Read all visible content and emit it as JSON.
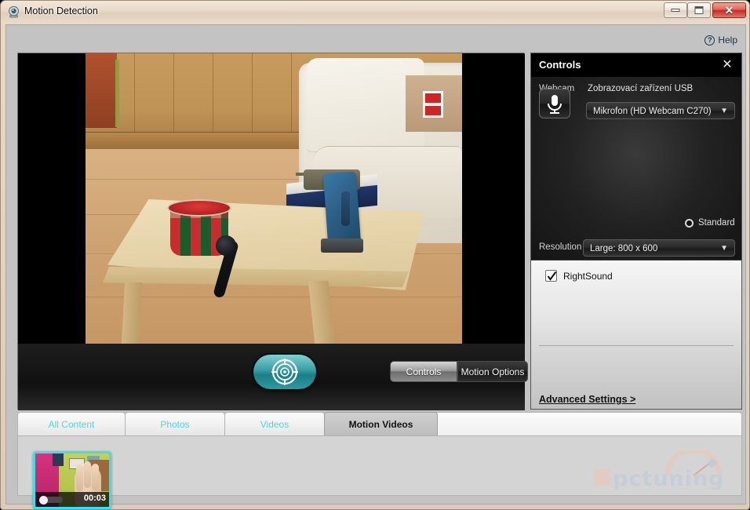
{
  "window": {
    "title": "Motion Detection",
    "icon": "webcam-icon",
    "minimize_label": "Minimize",
    "maximize_label": "Maximize",
    "close_label": "Close"
  },
  "help": {
    "label": "Help",
    "icon": "question-mark-icon"
  },
  "video": {
    "record_button_icon": "motion-target-icon",
    "segmented": {
      "controls_label": "Controls",
      "motion_options_label": "Motion Options",
      "active": "Controls"
    }
  },
  "controls": {
    "title": "Controls",
    "close_icon": "close-icon",
    "webcam_label": "Webcam",
    "webcam_value": "Zobrazovací zařízení USB",
    "mic_label": "Mic",
    "mic_value": "Mikrofon (HD Webcam C270)",
    "mic_button_icon": "microphone-icon",
    "quality_label": "Standard",
    "quality_radio_icon": "radio-selected-icon",
    "resolution_label": "Resolution",
    "resolution_value": "Large: 800 x 600",
    "rightsound_label": "RightSound",
    "rightsound_checked": true,
    "advanced_settings_label": "Advanced Settings >",
    "accent_color": "#3ce0ec"
  },
  "tabs": [
    {
      "label": "All Content",
      "active": false
    },
    {
      "label": "Photos",
      "active": false
    },
    {
      "label": "Videos",
      "active": false
    },
    {
      "label": "Motion Videos",
      "active": true
    }
  ],
  "content": {
    "items": [
      {
        "duration": "00:03",
        "type": "motion-video"
      }
    ]
  },
  "watermark": {
    "text": "pctuning"
  }
}
